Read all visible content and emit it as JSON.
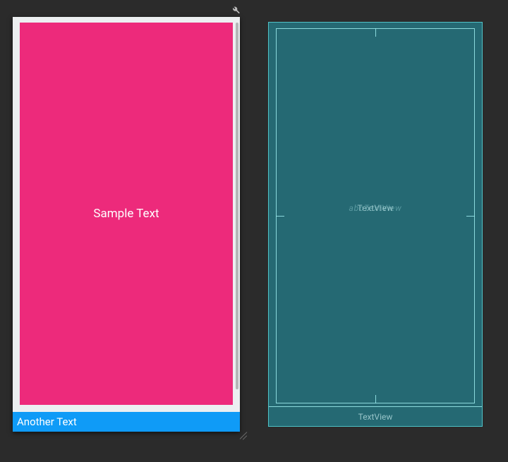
{
  "design": {
    "topBlock": {
      "text": "Sample Text",
      "bg": "#ed2a7b"
    },
    "bottomBlock": {
      "text": "Another Text",
      "bg": "#0f9bf7"
    }
  },
  "blueprint": {
    "centerLabel": "TextView",
    "bottomLabel": "TextView"
  },
  "icons": {
    "wrench": "wrench-icon"
  }
}
